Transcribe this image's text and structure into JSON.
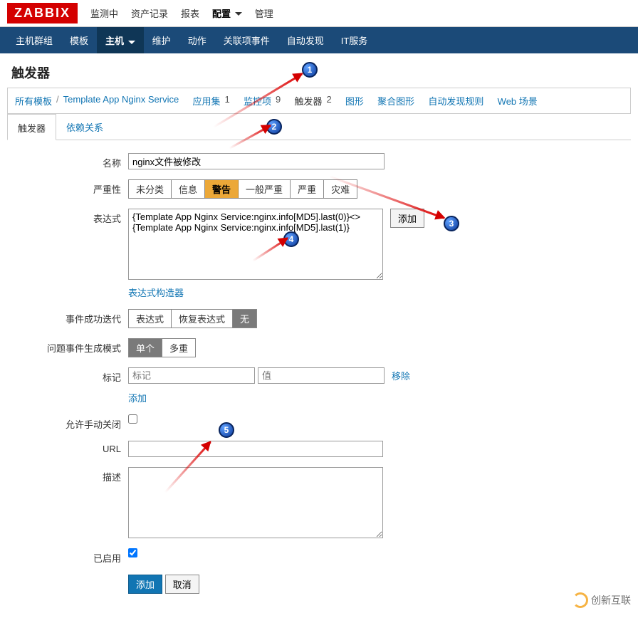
{
  "logo": "ZABBIX",
  "topnav": [
    "监测中",
    "资产记录",
    "报表",
    "配置",
    "管理"
  ],
  "topnav_active": 3,
  "subnav": [
    "主机群组",
    "模板",
    "主机",
    "维护",
    "动作",
    "关联项事件",
    "自动发现",
    "IT服务"
  ],
  "subnav_active": 2,
  "page_title": "触发器",
  "breadcrumb": {
    "all_templates": "所有模板",
    "template_name": "Template App Nginx Service",
    "items": [
      {
        "label": "应用集",
        "count": 1
      },
      {
        "label": "监控项",
        "count": 9
      },
      {
        "label": "触发器",
        "count": 2
      },
      {
        "label": "图形",
        "count": null
      },
      {
        "label": "聚合图形",
        "count": null
      },
      {
        "label": "自动发现规则",
        "count": null
      },
      {
        "label": "Web 场景",
        "count": null
      }
    ]
  },
  "tabs": [
    "触发器",
    "依赖关系"
  ],
  "active_tab": 0,
  "form": {
    "labels": {
      "name": "名称",
      "severity": "严重性",
      "expression": "表达式",
      "expr_constructor": "表达式构造器",
      "event_ok": "事件成功迭代",
      "problem_event_mode": "问题事件生成模式",
      "tags": "标记",
      "allow_manual_close": "允许手动关闭",
      "url": "URL",
      "desc": "描述",
      "enabled": "已启用"
    },
    "name_value": "nginx文件被修改",
    "severity_opts": [
      "未分类",
      "信息",
      "警告",
      "一般严重",
      "严重",
      "灾难"
    ],
    "severity_sel": 2,
    "expression_value": "{Template App Nginx Service:nginx.info[MD5].last(0)}<>{Template App Nginx Service:nginx.info[MD5].last(1)}",
    "add_btn": "添加",
    "event_ok_opts": [
      "表达式",
      "恢复表达式",
      "无"
    ],
    "event_ok_sel": 2,
    "problem_mode_opts": [
      "单个",
      "多重"
    ],
    "problem_mode_sel": 0,
    "tag_placeholder_name": "标记",
    "tag_placeholder_value": "值",
    "tag_remove": "移除",
    "tag_add": "添加",
    "allow_manual_close_checked": false,
    "url_value": "",
    "desc_value": "",
    "enabled_checked": true,
    "submit": "添加",
    "cancel": "取消"
  },
  "watermark": "创新互联"
}
